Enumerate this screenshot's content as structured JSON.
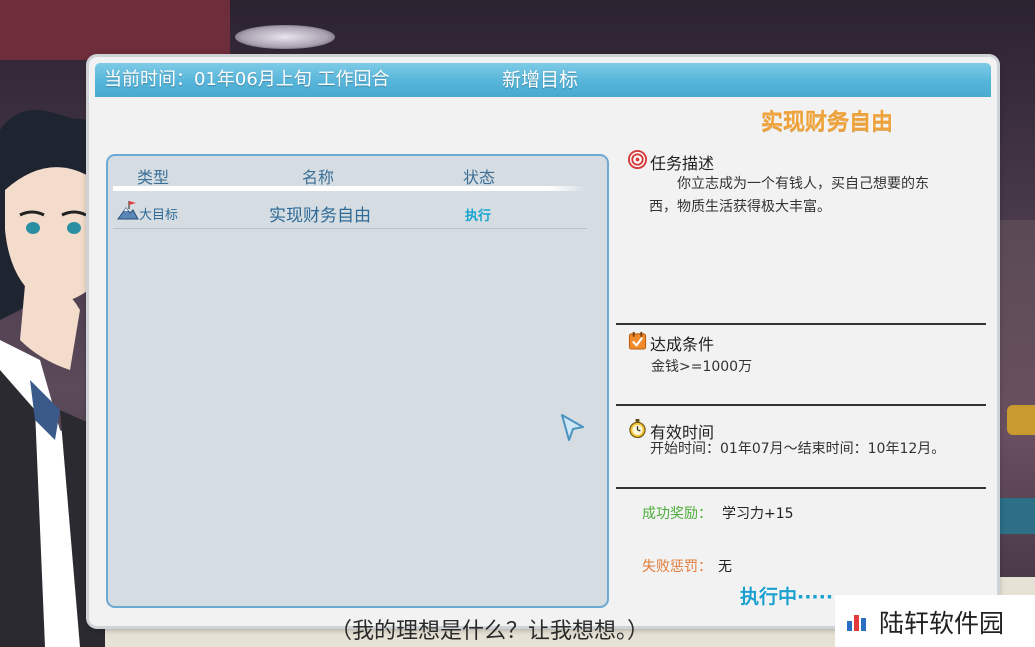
{
  "header": {
    "time_text": "当前时间：01年06月上旬 工作回合",
    "title": "新增目标"
  },
  "goal_list": {
    "columns": [
      "类型",
      "名称",
      "状态"
    ],
    "rows": [
      {
        "type": "大目标",
        "name": "实现财务自由",
        "status": "执行"
      }
    ]
  },
  "detail": {
    "goal_title": "实现财务自由",
    "description_label": "任务描述",
    "description": "你立志成为一个有钱人，买自己想要的东西，物质生活获得极大丰富。",
    "condition_label": "达成条件",
    "condition": "金钱>=1000万",
    "valid_time_label": "有效时间",
    "valid_time": "开始时间：01年07月～结束时间：10年12月。",
    "reward_label": "成功奖励：",
    "reward": "学习力+15",
    "penalty_label": "失败惩罚：",
    "penalty": "无",
    "status_text": "执行中······"
  },
  "subtitle": "（我的理想是什么？让我想想。）",
  "watermark": "陆轩软件园",
  "colors": {
    "title_bar": "#56b5da",
    "goal_title": "#f0a23a",
    "reward_label": "#4cae3b",
    "penalty_label": "#e07b38",
    "status_text": "#1b9fce"
  },
  "icons": {
    "description": "target-icon",
    "condition": "checklist-icon",
    "valid_time": "stopwatch-icon",
    "goal_type": "summit-flag-icon"
  }
}
